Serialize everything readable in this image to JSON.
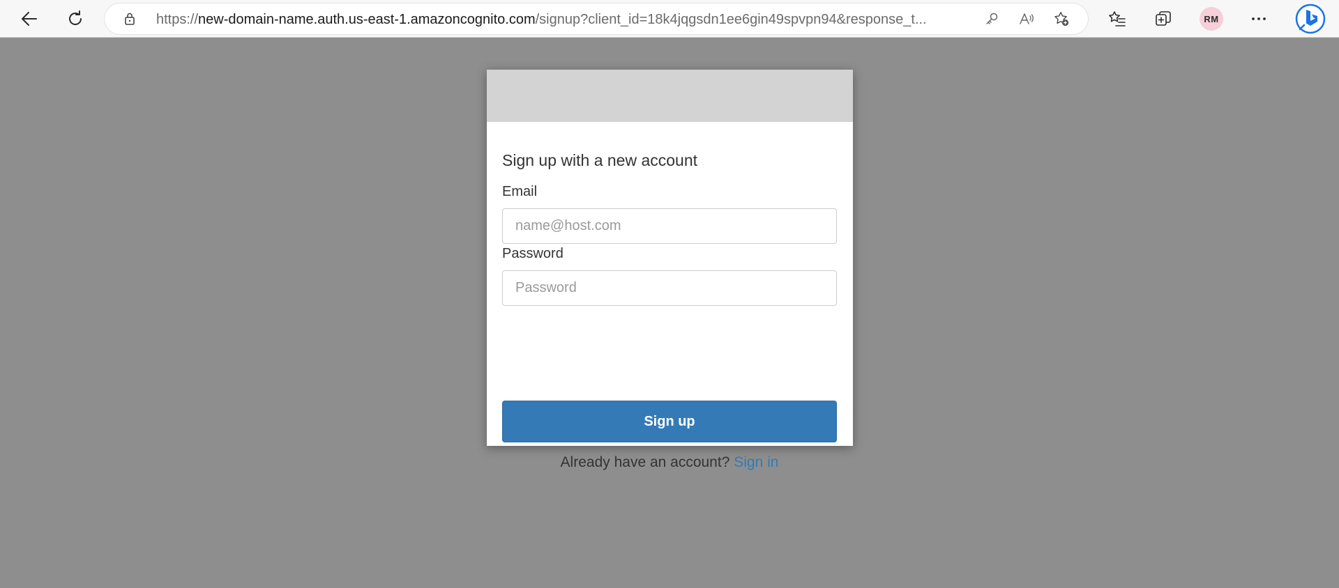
{
  "browser": {
    "url_prefix": "https://",
    "url_host": "new-domain-name.auth.us-east-1.amazoncognito.com",
    "url_rest": "/signup?client_id=18k4jqgsdn1ee6gin49spvpn94&response_t...",
    "profile_initials": "RM"
  },
  "signup": {
    "title": "Sign up with a new account",
    "email_label": "Email",
    "email_placeholder": "name@host.com",
    "email_value": "",
    "password_label": "Password",
    "password_placeholder": "Password",
    "password_value": "",
    "submit_label": "Sign up",
    "signin_prompt": "Already have an account?",
    "signin_link": "Sign in"
  },
  "icons": {
    "back": "arrow-left-icon",
    "refresh": "refresh-icon",
    "lock": "lock-icon",
    "key": "key-icon",
    "read_aloud": "read-aloud-icon",
    "add_favorite": "star-add-icon",
    "favorites": "favorites-icon",
    "collections": "collections-icon",
    "more": "more-icon",
    "bing": "bing-icon"
  },
  "colors": {
    "page_background": "#8e8e8e",
    "banner": "#d3d3d3",
    "primary_button": "#337ab7",
    "link": "#337ab7"
  }
}
